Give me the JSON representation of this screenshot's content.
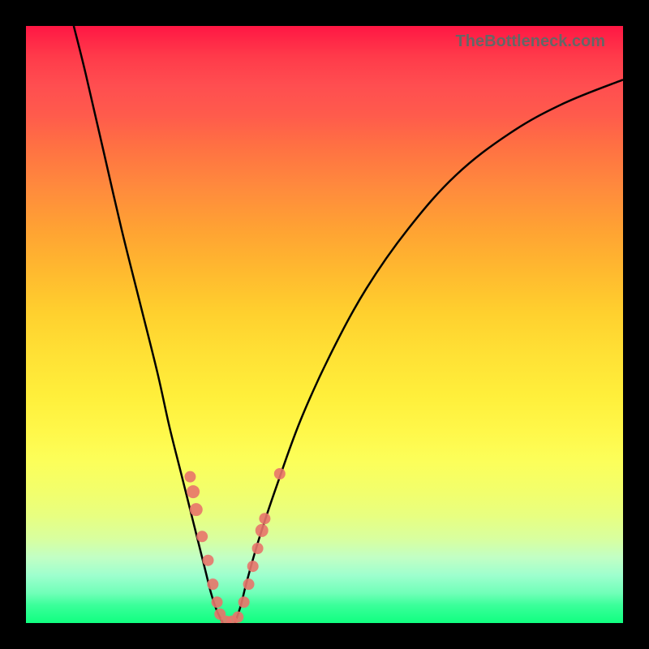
{
  "watermark": "TheBottleneck.com",
  "colors": {
    "gradient_top": "#ff1744",
    "gradient_bottom": "#10ff80",
    "curve": "#000000",
    "dots": "#e8746a",
    "frame": "#000000"
  },
  "chart_data": {
    "type": "line",
    "title": "",
    "xlabel": "",
    "ylabel": "",
    "xlim": [
      0,
      100
    ],
    "ylim": [
      0,
      100
    ],
    "left_curve": [
      {
        "x": 8,
        "y": 100
      },
      {
        "x": 10,
        "y": 92
      },
      {
        "x": 13,
        "y": 79
      },
      {
        "x": 16,
        "y": 66
      },
      {
        "x": 19,
        "y": 54
      },
      {
        "x": 22,
        "y": 42
      },
      {
        "x": 24,
        "y": 33
      },
      {
        "x": 26,
        "y": 25
      },
      {
        "x": 28,
        "y": 17
      },
      {
        "x": 30,
        "y": 9
      },
      {
        "x": 31,
        "y": 5
      },
      {
        "x": 32,
        "y": 2
      },
      {
        "x": 33,
        "y": 0
      }
    ],
    "right_curve": [
      {
        "x": 35,
        "y": 0
      },
      {
        "x": 36,
        "y": 3
      },
      {
        "x": 37,
        "y": 7
      },
      {
        "x": 39,
        "y": 14
      },
      {
        "x": 42,
        "y": 23
      },
      {
        "x": 46,
        "y": 34
      },
      {
        "x": 51,
        "y": 45
      },
      {
        "x": 57,
        "y": 56
      },
      {
        "x": 64,
        "y": 66
      },
      {
        "x": 72,
        "y": 75
      },
      {
        "x": 81,
        "y": 82
      },
      {
        "x": 90,
        "y": 87
      },
      {
        "x": 100,
        "y": 91
      }
    ],
    "markers": [
      {
        "x": 27.5,
        "y": 24.5,
        "r": 7
      },
      {
        "x": 28.0,
        "y": 22.0,
        "r": 8
      },
      {
        "x": 28.5,
        "y": 19.0,
        "r": 8
      },
      {
        "x": 29.5,
        "y": 14.5,
        "r": 7
      },
      {
        "x": 30.5,
        "y": 10.5,
        "r": 7
      },
      {
        "x": 31.3,
        "y": 6.5,
        "r": 7
      },
      {
        "x": 32.0,
        "y": 3.5,
        "r": 7
      },
      {
        "x": 32.5,
        "y": 1.5,
        "r": 7
      },
      {
        "x": 33.5,
        "y": 0.3,
        "r": 7
      },
      {
        "x": 34.5,
        "y": 0.3,
        "r": 7
      },
      {
        "x": 35.5,
        "y": 1.0,
        "r": 7
      },
      {
        "x": 36.5,
        "y": 3.5,
        "r": 7
      },
      {
        "x": 37.3,
        "y": 6.5,
        "r": 7
      },
      {
        "x": 38.0,
        "y": 9.5,
        "r": 7
      },
      {
        "x": 38.8,
        "y": 12.5,
        "r": 7
      },
      {
        "x": 39.5,
        "y": 15.5,
        "r": 8
      },
      {
        "x": 40.0,
        "y": 17.5,
        "r": 7
      },
      {
        "x": 42.5,
        "y": 25.0,
        "r": 7
      }
    ]
  }
}
